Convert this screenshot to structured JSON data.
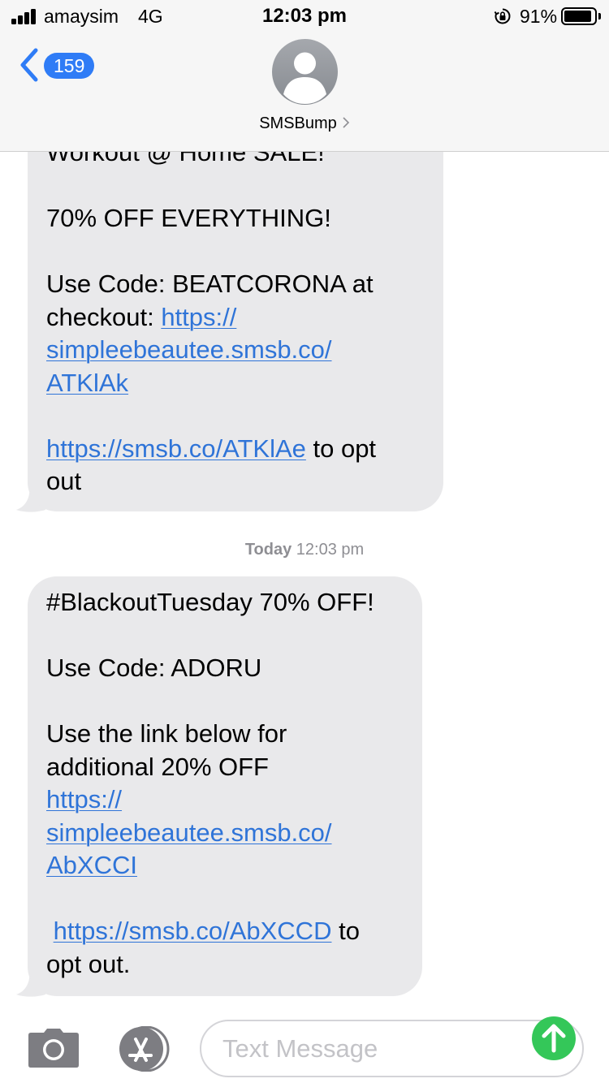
{
  "status_bar": {
    "carrier": "amaysim",
    "network": "4G",
    "time": "12:03 pm",
    "battery_percent": "91%",
    "battery_level": 0.91
  },
  "header": {
    "back_count": "159",
    "contact_name": "SMSBump",
    "avatar_icon": "person-silhouette-icon",
    "accent_color": "#2f7cf6"
  },
  "messages": [
    {
      "clipped_top_line": "Workout @ Home SALE!",
      "line_1": "70% OFF EVERYTHING!",
      "line_2": "Use Code: BEATCORONA at",
      "line_3_text": "checkout: ",
      "link_1a": "https://",
      "link_1b": "simpleebeautee.smsb.co/",
      "link_1c": "ATKlAk",
      "opt_out_link": "https://smsb.co/ATKlAe",
      "opt_out_text_1": " to opt",
      "opt_out_text_2": "out"
    },
    {
      "line_1": "#BlackoutTuesday 70% OFF!",
      "line_2": "Use Code: ADORU",
      "line_3": "Use the link below for",
      "line_4": "additional 20% OFF",
      "link_1a": "https://",
      "link_1b": "simpleebeautee.smsb.co/",
      "link_1c": "AbXCCI",
      "opt_out_link": "https://smsb.co/AbXCCD",
      "opt_out_text_1": " to",
      "opt_out_text_2": "opt out."
    }
  ],
  "timestamp": {
    "day": "Today",
    "time": "12:03 pm"
  },
  "input_bar": {
    "placeholder": "Text Message",
    "camera_icon": "camera-icon",
    "apps_icon": "app-store-icon",
    "send_icon": "send-arrow-up-icon",
    "send_color": "#34c759"
  },
  "colors": {
    "bubble_background": "#e9e9eb",
    "link": "#2f74d8"
  }
}
